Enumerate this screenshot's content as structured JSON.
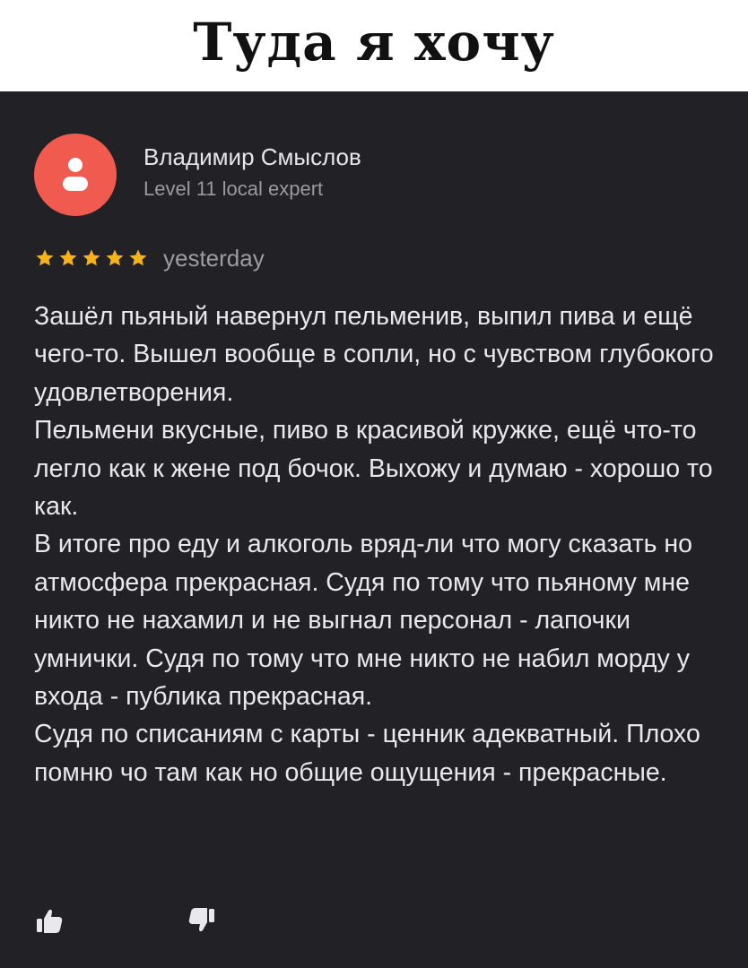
{
  "header": {
    "title": "Туда я хочу"
  },
  "review": {
    "author": {
      "name": "Владимир Смыслов",
      "level": "Level 11 local expert"
    },
    "rating": 5,
    "date": "yesterday",
    "paragraphs": [
      "Зашёл пьяный навернул пельменив, выпил пива и ещё чего-то. Вышел вообще в сопли, но с чувством глубокого удовлетворения.",
      "Пельмени вкусные, пиво в красивой кружке, ещё что-то легло как к жене под бочок. Выхожу и думаю - хорошо то как.",
      "В итоге про еду и алкоголь вряд-ли что могу сказать но атмосфера прекрасная. Судя по тому что пьяному мне никто не нахамил и не выгнал персонал - лапочки умнички. Судя по тому что мне никто не набил морду у входа - публика прекрасная.",
      "Судя по списаниям с карты - ценник адекватный. Плохо помню чо там как но общие ощущения - прекрасные."
    ]
  },
  "icons": {
    "avatar": "user-icon",
    "star": "star-icon",
    "like": "thumbs-up-icon",
    "dislike": "thumbs-down-icon"
  },
  "colors": {
    "card_background": "#222125",
    "avatar_background": "#f15a4f",
    "star": "#f4b21b",
    "text": "#e9e9eb",
    "muted_text": "#9a9aa0"
  }
}
